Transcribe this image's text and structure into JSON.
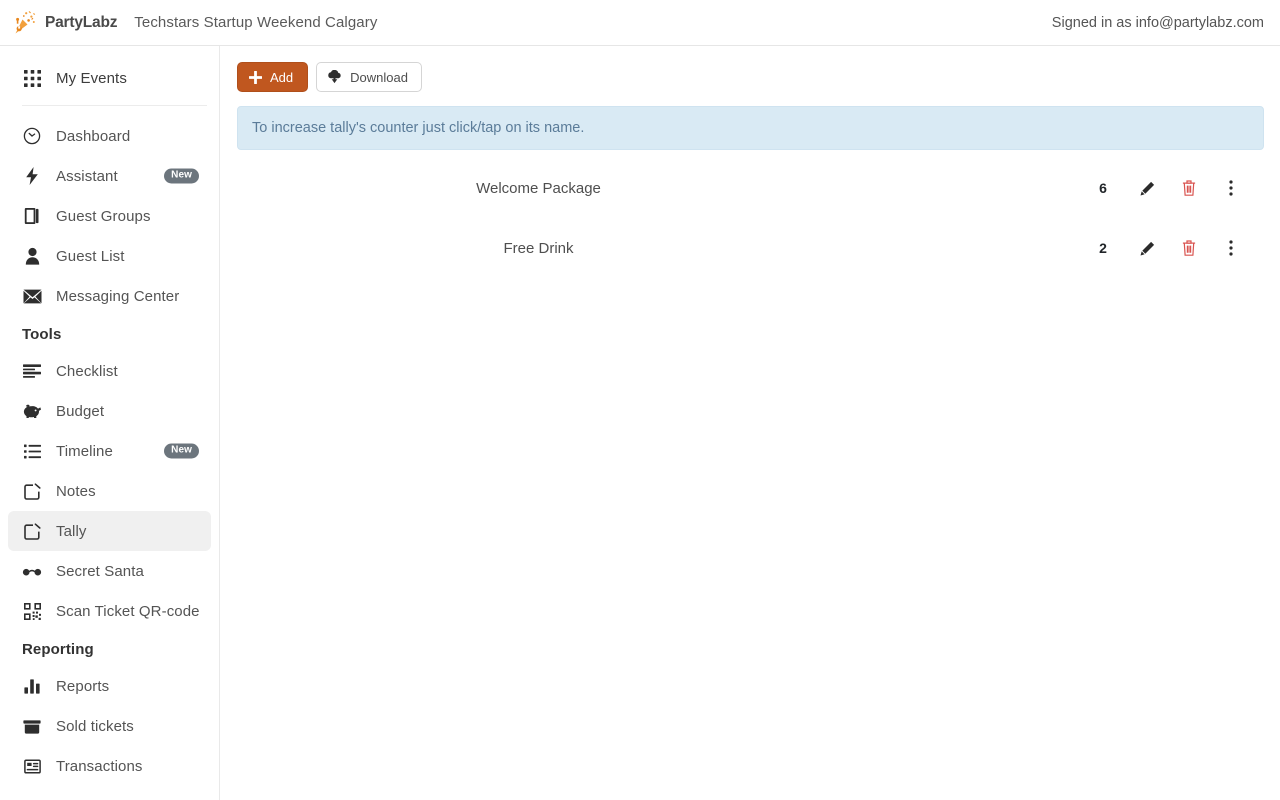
{
  "header": {
    "brand_name": "PartyLabz",
    "brand_icon": "party-popper-logo-icon",
    "event_title": "Techstars Startup Weekend Calgary",
    "signed_in_text": "Signed in as info@partylabz.com"
  },
  "sidebar": {
    "top_items": [
      {
        "label": "My Events",
        "icon": "grid-icon"
      }
    ],
    "primary_items": [
      {
        "label": "Dashboard",
        "icon": "gauge-icon",
        "badge": null
      },
      {
        "label": "Assistant",
        "icon": "bolt-icon",
        "badge": "New"
      },
      {
        "label": "Guest Groups",
        "icon": "book-icon",
        "badge": null
      },
      {
        "label": "Guest List",
        "icon": "person-icon",
        "badge": null
      },
      {
        "label": "Messaging Center",
        "icon": "envelope-icon",
        "badge": null
      }
    ],
    "sections": [
      {
        "title": "Tools",
        "items": [
          {
            "label": "Checklist",
            "icon": "checklist-icon",
            "badge": null,
            "active": false
          },
          {
            "label": "Budget",
            "icon": "piggy-bank-icon",
            "badge": null,
            "active": false
          },
          {
            "label": "Timeline",
            "icon": "list-icon",
            "badge": "New",
            "active": false
          },
          {
            "label": "Notes",
            "icon": "note-edit-icon",
            "badge": null,
            "active": false
          },
          {
            "label": "Tally",
            "icon": "note-edit-icon",
            "badge": null,
            "active": true
          },
          {
            "label": "Secret Santa",
            "icon": "glasses-icon",
            "badge": null,
            "active": false
          },
          {
            "label": "Scan Ticket QR-code",
            "icon": "qr-code-icon",
            "badge": null,
            "active": false
          }
        ]
      },
      {
        "title": "Reporting",
        "items": [
          {
            "label": "Reports",
            "icon": "bar-chart-icon",
            "badge": null,
            "active": false
          },
          {
            "label": "Sold tickets",
            "icon": "ticket-box-icon",
            "badge": null,
            "active": false
          },
          {
            "label": "Transactions",
            "icon": "transactions-icon",
            "badge": null,
            "active": false
          }
        ]
      }
    ]
  },
  "main": {
    "toolbar": {
      "add_label": "Add",
      "add_icon": "plus-icon",
      "download_label": "Download",
      "download_icon": "cloud-download-icon"
    },
    "alert": {
      "text": "To increase tally's counter just click/tap on its name."
    },
    "tally_rows": [
      {
        "name": "Welcome Package",
        "count": "6"
      },
      {
        "name": "Free Drink",
        "count": "2"
      }
    ],
    "row_action_icons": {
      "edit": "pencil-icon",
      "delete": "trash-icon",
      "more": "vertical-dots-icon"
    }
  },
  "colors": {
    "accent": "#c0571f",
    "alert_bg": "#d9eaf4",
    "alert_text": "#5b7c99",
    "badge_bg": "#6c757d",
    "delete": "#d9534f",
    "active_item_bg": "#f0f0f0"
  }
}
